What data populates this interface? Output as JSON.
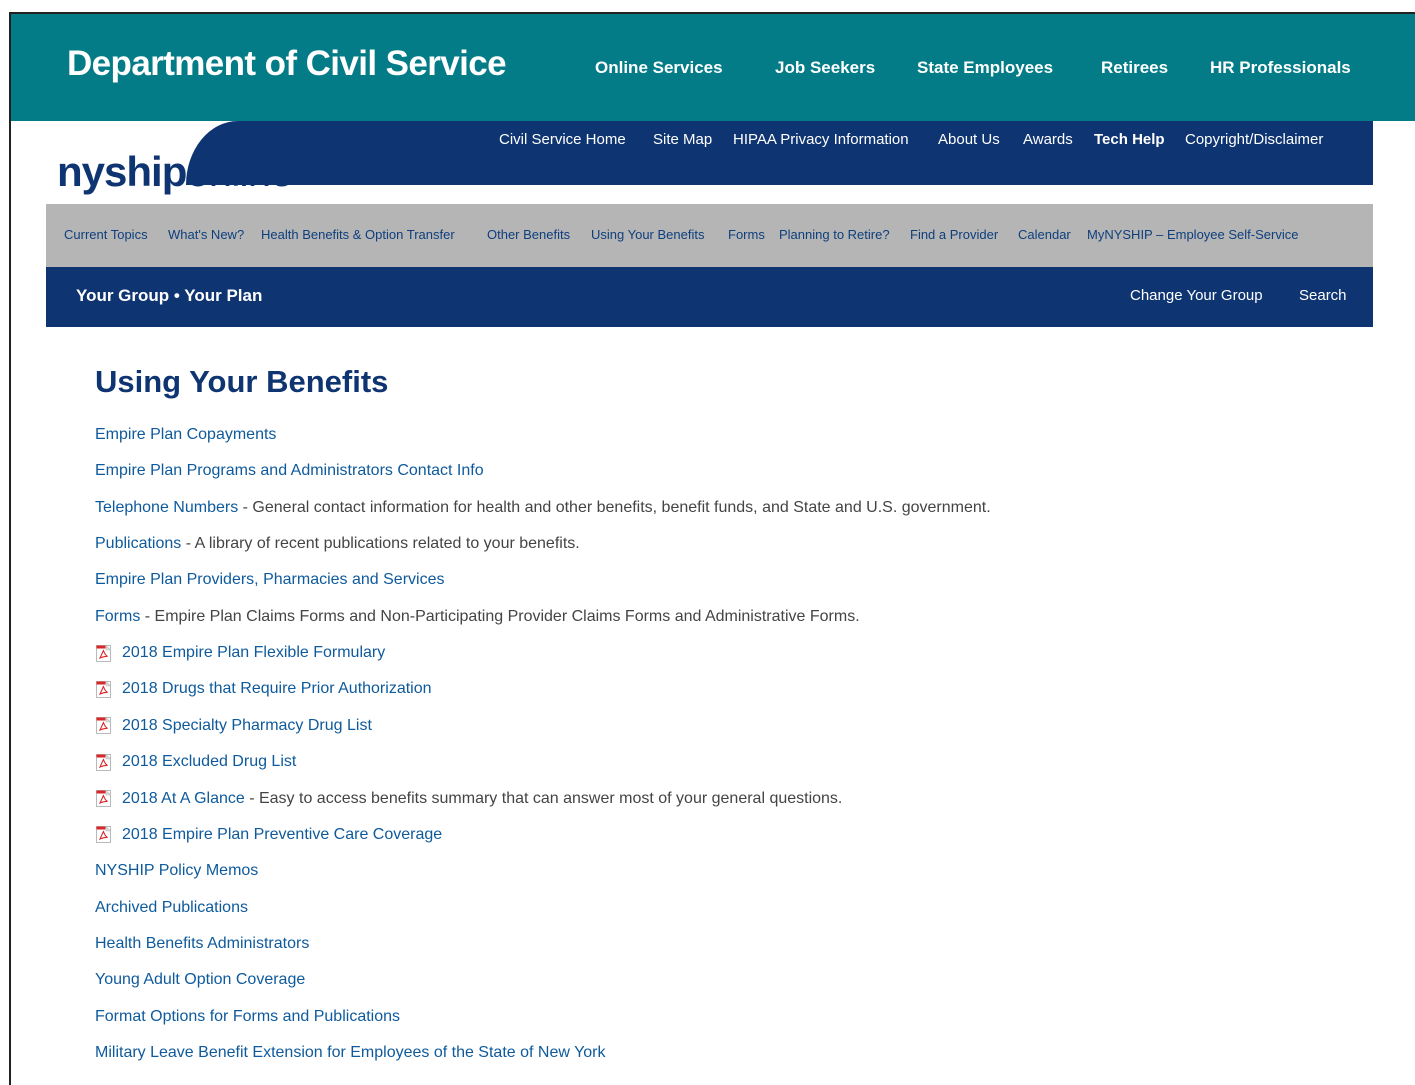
{
  "header": {
    "title": "Department of Civil Service",
    "nav": [
      "Online Services",
      "Job Seekers",
      "State Employees",
      "Retirees",
      "HR Professionals"
    ]
  },
  "utility_nav": [
    "Civil Service Home",
    "Site Map",
    "HIPAA Privacy Information",
    "About Us",
    "Awards",
    "Tech Help",
    "Copyright/Disclaimer"
  ],
  "logo": {
    "part1": "nyship",
    "part2": "online"
  },
  "secondary_nav": [
    "Current Topics",
    "What's New?",
    "Health Benefits & Option Transfer",
    "Other Benefits",
    "Using Your Benefits",
    "Forms",
    "Planning to Retire?",
    "Find a Provider",
    "Calendar",
    "MyNYSHIP – Employee Self-Service"
  ],
  "group_bar": {
    "label": "Your Group • Your Plan",
    "change_group": "Change Your Group",
    "search": "Search"
  },
  "main": {
    "title": "Using Your Benefits",
    "links": [
      {
        "label": "Empire Plan Copayments",
        "desc": "",
        "pdf": false
      },
      {
        "label": "Empire Plan Programs and Administrators Contact Info",
        "desc": "",
        "pdf": false
      },
      {
        "label": "Telephone Numbers",
        "desc": " - General contact information for health and other benefits, benefit funds, and State and U.S. government.",
        "pdf": false
      },
      {
        "label": "Publications",
        "desc": " - A library of recent publications related to your benefits.",
        "pdf": false
      },
      {
        "label": "Empire Plan Providers, Pharmacies and Services",
        "desc": "",
        "pdf": false
      },
      {
        "label": "Forms",
        "desc": " - Empire Plan Claims Forms and Non-Participating Provider Claims Forms and Administrative Forms.",
        "pdf": false
      },
      {
        "label": "2018 Empire Plan Flexible Formulary",
        "desc": "",
        "pdf": true
      },
      {
        "label": "2018 Drugs that Require Prior Authorization",
        "desc": "",
        "pdf": true
      },
      {
        "label": "2018 Specialty Pharmacy Drug List",
        "desc": "",
        "pdf": true
      },
      {
        "label": "2018 Excluded Drug List",
        "desc": "",
        "pdf": true
      },
      {
        "label": "2018 At A Glance",
        "desc": " - Easy to access benefits summary that can answer most of your general questions.",
        "pdf": true
      },
      {
        "label": "2018 Empire Plan Preventive Care Coverage",
        "desc": "",
        "pdf": true
      },
      {
        "label": "NYSHIP Policy Memos",
        "desc": "",
        "pdf": false
      },
      {
        "label": "Archived Publications",
        "desc": "",
        "pdf": false
      },
      {
        "label": "Health Benefits Administrators",
        "desc": "",
        "pdf": false
      },
      {
        "label": "Young Adult Option Coverage",
        "desc": "",
        "pdf": false
      },
      {
        "label": "Format Options for Forms and Publications",
        "desc": "",
        "pdf": false
      },
      {
        "label": "Military Leave Benefit Extension for Employees of the State of New York",
        "desc": "",
        "pdf": false
      }
    ]
  },
  "colors": {
    "teal": "#037c87",
    "navy": "#0e3471",
    "gray_nav": "#b5b5b5",
    "link": "#0e5a9c"
  }
}
